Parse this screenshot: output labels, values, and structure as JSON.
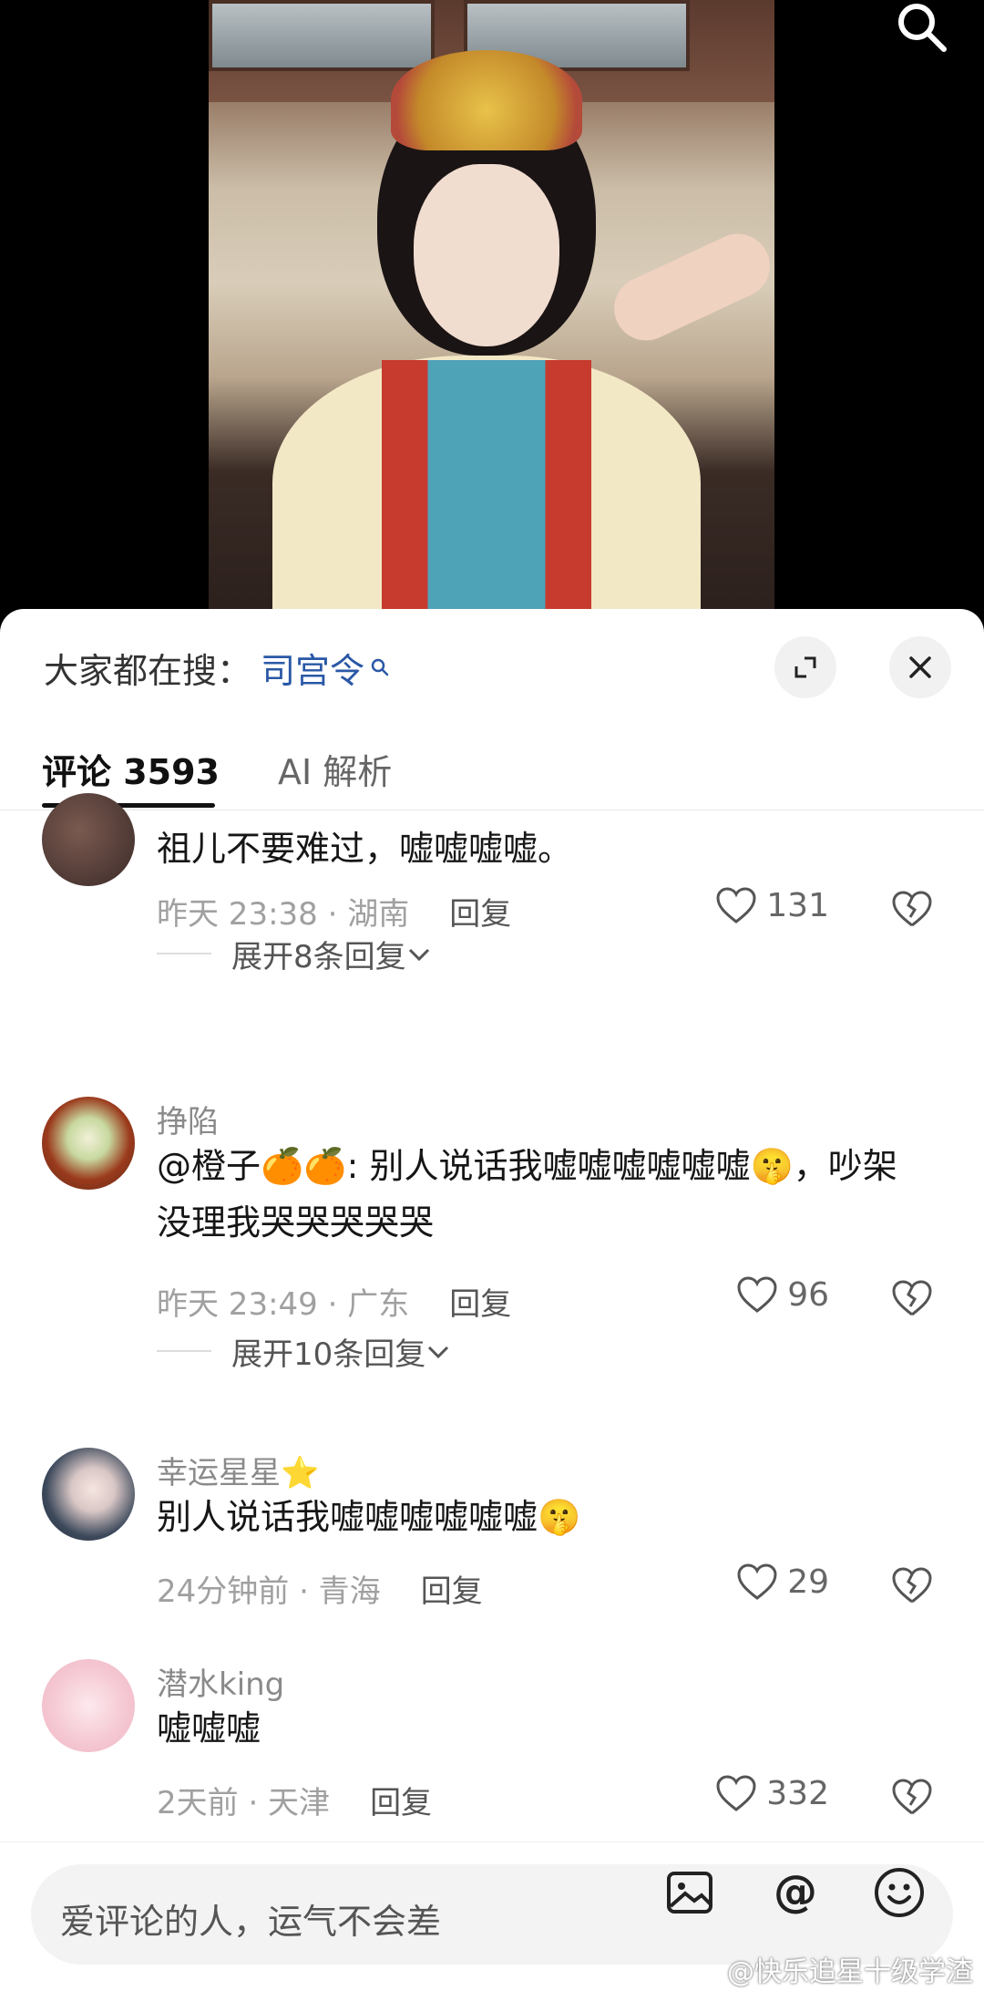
{
  "trending": {
    "prefix": "大家都在搜：",
    "keyword": "司宫令"
  },
  "tabs": {
    "comments": "评论 3593",
    "ai": "AI 解析"
  },
  "comments": [
    {
      "name": "",
      "text": "祖儿不要难过，嘘嘘嘘嘘。",
      "time": "昨天 23:38 · 湖南",
      "reply": "回复",
      "likes": "131",
      "expand": "展开8条回复"
    },
    {
      "name": "挣陷",
      "text": "@橙子🍊🍊: 别人说话我嘘嘘嘘嘘嘘嘘🤫，吵架没理我哭哭哭哭哭",
      "time": "昨天 23:49 · 广东",
      "reply": "回复",
      "likes": "96",
      "expand": "展开10条回复"
    },
    {
      "name": "幸运星星⭐",
      "text": "别人说话我嘘嘘嘘嘘嘘嘘🤫",
      "time": "24分钟前 · 青海",
      "reply": "回复",
      "likes": "29"
    },
    {
      "name": "潜水king",
      "text": "嘘嘘嘘",
      "time": "2天前 · 天津",
      "reply": "回复",
      "likes": "332"
    }
  ],
  "input": {
    "placeholder": "爱评论的人，运气不会差"
  },
  "watermark": "@快乐追星十级学渣",
  "colors": {
    "keyword": "#2a58a6",
    "sheet_bg": "#ffffff",
    "text": "#161616",
    "muted": "#a0a0a0"
  }
}
